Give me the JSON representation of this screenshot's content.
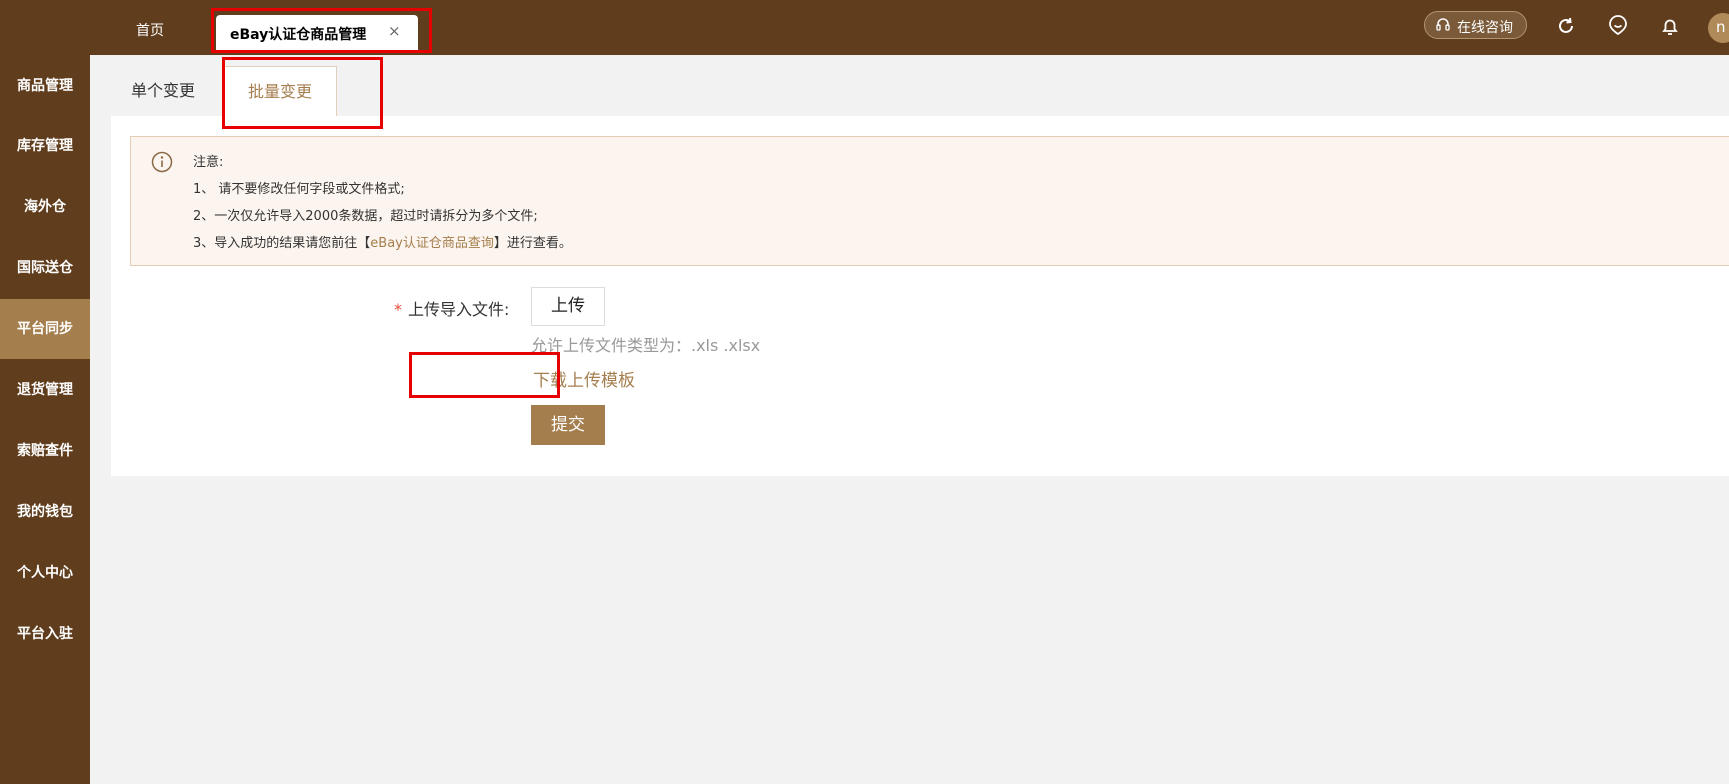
{
  "sidebar": {
    "items": [
      {
        "label": "商品管理"
      },
      {
        "label": "库存管理"
      },
      {
        "label": "海外仓"
      },
      {
        "label": "国际送仓"
      },
      {
        "label": "平台同步"
      },
      {
        "label": "退货管理"
      },
      {
        "label": "索赔查件"
      },
      {
        "label": "我的钱包"
      },
      {
        "label": "个人中心"
      },
      {
        "label": "平台入驻"
      }
    ]
  },
  "header": {
    "tabs": {
      "home": "首页",
      "active": "eBay认证仓商品管理",
      "close": "×"
    },
    "consult_label": "在线咨询",
    "avatar_initial": "n"
  },
  "subtabs": {
    "single": "单个变更",
    "batch": "批量变更"
  },
  "notice": {
    "title": "注意:",
    "line1": "1、 请不要修改任何字段或文件格式;",
    "line2": "2、一次仅允许导入2000条数据，超过时请拆分为多个文件;",
    "line3_prefix": "3、导入成功的结果请您前往【",
    "line3_link": "eBay认证仓商品查询",
    "line3_suffix": "】进行查看。"
  },
  "form": {
    "required_mark": "*",
    "label": "上传导入文件:",
    "upload_button": "上传",
    "hint": "允许上传文件类型为：.xls .xlsx",
    "download_link": "下载上传模板",
    "submit_button": "提交"
  },
  "colors": {
    "brand": "#603d1d",
    "accent": "#a57e4d",
    "highlight": "#e60000"
  }
}
